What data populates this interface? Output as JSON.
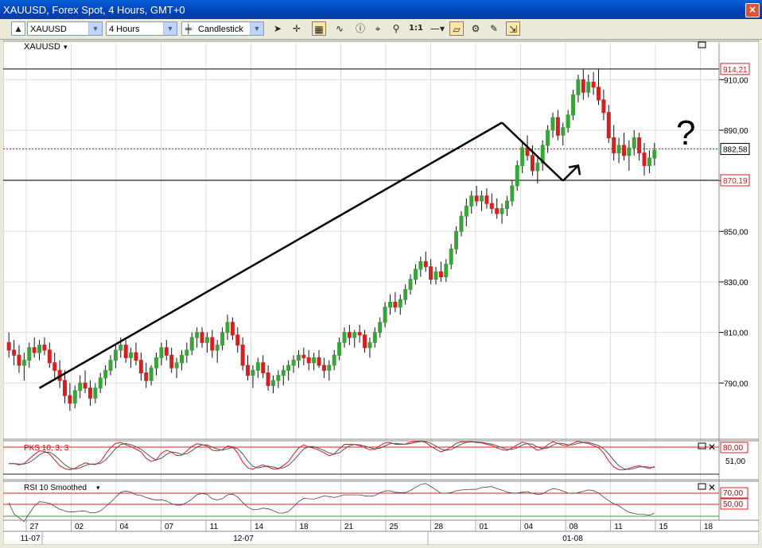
{
  "window": {
    "title": "XAUUSD, Forex Spot, 4 Hours, GMT+0",
    "close_glyph": "×"
  },
  "toolbar": {
    "symbol": "XAUUSD",
    "timeframe": "4 Hours",
    "chart_style": "Candlestick",
    "ratio_label": "1:1",
    "icons": [
      "scroll-up-icon",
      "candlestick-icon",
      "cursor-icon",
      "crosshair-icon",
      "grid-icon",
      "indicator-icon",
      "info-icon",
      "zoom-area-icon",
      "magnify-icon",
      "line-style-icon",
      "eraser-icon",
      "template-icon",
      "drawing-tool-icon",
      "autoscale-icon"
    ]
  },
  "panels": {
    "main": {
      "instrument_label": "XAUUSD"
    },
    "stoch": {
      "label": "PKS 10, 3, 3",
      "levels_label": [
        "80,00",
        "51,00"
      ]
    },
    "rsi": {
      "label": "RSI 10 Smoothed",
      "levels_label": [
        "70,00",
        "50,00"
      ]
    }
  },
  "colors": {
    "bull": "#3aa33a",
    "bear": "#d42020",
    "price_line": "#d42020",
    "grid": "#dddddd",
    "level_red": "#d42020"
  },
  "chart_data": {
    "type": "candlestick",
    "ylim": [
      775,
      917
    ],
    "y_ticks": [
      "790,00",
      "810,00",
      "830,00",
      "850,00",
      "870,00",
      "890,00",
      "910,00"
    ],
    "y_tick_values": [
      790,
      810,
      830,
      850,
      870,
      890,
      910
    ],
    "price_labels": [
      {
        "value": 914.21,
        "label": "914,21",
        "style": "level"
      },
      {
        "value": 882.58,
        "label": "882,58",
        "style": "current"
      },
      {
        "value": 870.19,
        "label": "870,19",
        "style": "level"
      }
    ],
    "x_ticks": [
      "27",
      "02",
      "04",
      "07",
      "11",
      "14",
      "18",
      "21",
      "25",
      "28",
      "01",
      "04",
      "08",
      "11",
      "15",
      "18"
    ],
    "x_periods": [
      "11-07",
      "12-07",
      "01-08"
    ],
    "annotations": {
      "text": "?"
    },
    "candles": [
      [
        806,
        810,
        800,
        803
      ],
      [
        803,
        807,
        797,
        801
      ],
      [
        801,
        805,
        794,
        797
      ],
      [
        797,
        802,
        791,
        799
      ],
      [
        799,
        806,
        796,
        804
      ],
      [
        804,
        808,
        800,
        802
      ],
      [
        802,
        807,
        799,
        805
      ],
      [
        805,
        808,
        801,
        803
      ],
      [
        803,
        806,
        796,
        798
      ],
      [
        798,
        802,
        792,
        795
      ],
      [
        795,
        799,
        788,
        791
      ],
      [
        791,
        795,
        782,
        785
      ],
      [
        785,
        790,
        779,
        782
      ],
      [
        782,
        789,
        780,
        787
      ],
      [
        787,
        793,
        784,
        790
      ],
      [
        790,
        795,
        786,
        788
      ],
      [
        788,
        791,
        781,
        784
      ],
      [
        784,
        790,
        782,
        788
      ],
      [
        788,
        794,
        786,
        792
      ],
      [
        792,
        797,
        789,
        795
      ],
      [
        795,
        801,
        793,
        799
      ],
      [
        799,
        805,
        796,
        803
      ],
      [
        803,
        808,
        800,
        805
      ],
      [
        805,
        807,
        798,
        800
      ],
      [
        800,
        804,
        796,
        802
      ],
      [
        802,
        806,
        797,
        799
      ],
      [
        799,
        802,
        791,
        794
      ],
      [
        794,
        798,
        788,
        791
      ],
      [
        791,
        797,
        789,
        796
      ],
      [
        796,
        802,
        793,
        800
      ],
      [
        800,
        806,
        797,
        804
      ],
      [
        804,
        807,
        799,
        801
      ],
      [
        801,
        804,
        794,
        796
      ],
      [
        796,
        800,
        792,
        798
      ],
      [
        798,
        803,
        795,
        801
      ],
      [
        801,
        806,
        798,
        803
      ],
      [
        803,
        810,
        801,
        808
      ],
      [
        808,
        812,
        804,
        810
      ],
      [
        810,
        812,
        804,
        806
      ],
      [
        806,
        810,
        802,
        808
      ],
      [
        808,
        811,
        800,
        803
      ],
      [
        803,
        807,
        798,
        805
      ],
      [
        805,
        812,
        803,
        810
      ],
      [
        810,
        817,
        807,
        814
      ],
      [
        814,
        816,
        807,
        809
      ],
      [
        809,
        812,
        802,
        805
      ],
      [
        805,
        808,
        795,
        797
      ],
      [
        797,
        801,
        791,
        793
      ],
      [
        793,
        797,
        788,
        795
      ],
      [
        795,
        800,
        792,
        798
      ],
      [
        798,
        801,
        792,
        794
      ],
      [
        794,
        797,
        787,
        789
      ],
      [
        789,
        793,
        786,
        791
      ],
      [
        791,
        795,
        788,
        793
      ],
      [
        793,
        797,
        789,
        795
      ],
      [
        795,
        799,
        791,
        797
      ],
      [
        797,
        801,
        794,
        799
      ],
      [
        799,
        803,
        796,
        801
      ],
      [
        801,
        804,
        797,
        800
      ],
      [
        800,
        803,
        795,
        798
      ],
      [
        798,
        802,
        795,
        800
      ],
      [
        800,
        803,
        796,
        797
      ],
      [
        797,
        800,
        792,
        795
      ],
      [
        795,
        799,
        791,
        797
      ],
      [
        797,
        803,
        795,
        801
      ],
      [
        801,
        808,
        799,
        806
      ],
      [
        806,
        812,
        804,
        810
      ],
      [
        810,
        813,
        805,
        808
      ],
      [
        808,
        811,
        804,
        810
      ],
      [
        810,
        813,
        806,
        809
      ],
      [
        809,
        811,
        802,
        804
      ],
      [
        804,
        808,
        800,
        806
      ],
      [
        806,
        812,
        804,
        810
      ],
      [
        810,
        816,
        808,
        814
      ],
      [
        814,
        822,
        812,
        820
      ],
      [
        820,
        825,
        817,
        822
      ],
      [
        822,
        826,
        818,
        820
      ],
      [
        820,
        825,
        817,
        823
      ],
      [
        823,
        829,
        821,
        827
      ],
      [
        827,
        833,
        825,
        831
      ],
      [
        831,
        837,
        829,
        835
      ],
      [
        835,
        840,
        832,
        838
      ],
      [
        838,
        842,
        834,
        836
      ],
      [
        836,
        839,
        829,
        831
      ],
      [
        831,
        836,
        829,
        834
      ],
      [
        834,
        838,
        830,
        832
      ],
      [
        832,
        839,
        830,
        837
      ],
      [
        837,
        845,
        835,
        843
      ],
      [
        843,
        852,
        841,
        850
      ],
      [
        850,
        858,
        848,
        856
      ],
      [
        856,
        863,
        852,
        860
      ],
      [
        860,
        866,
        857,
        864
      ],
      [
        864,
        868,
        860,
        862
      ],
      [
        862,
        866,
        858,
        864
      ],
      [
        864,
        867,
        859,
        861
      ],
      [
        861,
        865,
        857,
        859
      ],
      [
        859,
        863,
        855,
        857
      ],
      [
        857,
        861,
        853,
        859
      ],
      [
        859,
        864,
        856,
        862
      ],
      [
        862,
        870,
        860,
        868
      ],
      [
        868,
        878,
        866,
        876
      ],
      [
        876,
        885,
        873,
        883
      ],
      [
        883,
        888,
        878,
        880
      ],
      [
        880,
        884,
        872,
        874
      ],
      [
        874,
        879,
        869,
        877
      ],
      [
        877,
        886,
        874,
        884
      ],
      [
        884,
        892,
        881,
        890
      ],
      [
        890,
        897,
        887,
        895
      ],
      [
        895,
        898,
        886,
        888
      ],
      [
        888,
        893,
        884,
        891
      ],
      [
        891,
        898,
        889,
        896
      ],
      [
        896,
        906,
        894,
        904
      ],
      [
        904,
        912,
        901,
        910
      ],
      [
        910,
        914,
        902,
        905
      ],
      [
        905,
        912,
        903,
        909
      ],
      [
        909,
        913,
        904,
        907
      ],
      [
        907,
        914,
        900,
        902
      ],
      [
        902,
        906,
        894,
        897
      ],
      [
        897,
        900,
        885,
        887
      ],
      [
        887,
        892,
        878,
        881
      ],
      [
        881,
        887,
        877,
        884
      ],
      [
        884,
        889,
        878,
        880
      ],
      [
        880,
        886,
        874,
        883
      ],
      [
        883,
        890,
        880,
        887
      ],
      [
        887,
        889,
        878,
        881
      ],
      [
        881,
        885,
        872,
        876
      ],
      [
        876,
        882,
        873,
        879
      ],
      [
        879,
        885,
        876,
        882
      ]
    ],
    "trendlines": [
      {
        "from": [
          6,
          788
        ],
        "to": [
          97,
          893
        ]
      },
      {
        "from": [
          97,
          893
        ],
        "to": [
          109,
          870
        ]
      },
      {
        "from": [
          109,
          870
        ],
        "to": [
          112,
          876
        ]
      }
    ]
  }
}
